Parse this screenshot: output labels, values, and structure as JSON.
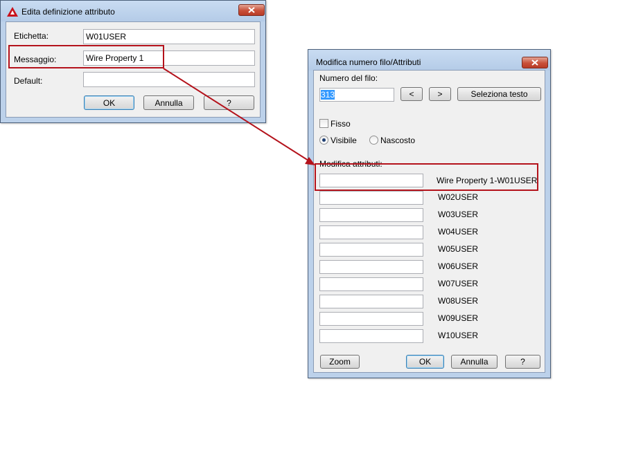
{
  "dialog1": {
    "title": "Edita definizione attributo",
    "fields": [
      {
        "label": "Etichetta:",
        "value": "W01USER"
      },
      {
        "label": "Messaggio:",
        "value": "Wire Property 1"
      },
      {
        "label": "Default:",
        "value": ""
      }
    ],
    "buttons": {
      "ok": "OK",
      "cancel": "Annulla",
      "help": "?"
    }
  },
  "dialog2": {
    "title": "Modifica numero filo/Attributi",
    "wire_number_label": "Numero del filo:",
    "wire_number_value": "313",
    "prev": "<",
    "next": ">",
    "select_text": "Seleziona testo",
    "fixed_label": "Fisso",
    "visible_label": "Visibile",
    "hidden_label": "Nascosto",
    "edit_attributes_label": "Modifica attributi:",
    "attributes": [
      {
        "value": "",
        "name": "Wire Property 1-W01USER"
      },
      {
        "value": "",
        "name": "W02USER"
      },
      {
        "value": "",
        "name": "W03USER"
      },
      {
        "value": "",
        "name": "W04USER"
      },
      {
        "value": "",
        "name": "W05USER"
      },
      {
        "value": "",
        "name": "W06USER"
      },
      {
        "value": "",
        "name": "W07USER"
      },
      {
        "value": "",
        "name": "W08USER"
      },
      {
        "value": "",
        "name": "W09USER"
      },
      {
        "value": "",
        "name": "W10USER"
      }
    ],
    "buttons": {
      "zoom": "Zoom",
      "ok": "OK",
      "cancel": "Annulla",
      "help": "?"
    }
  },
  "colors": {
    "highlight": "#b4121b",
    "title_bar": "#c9dcf2",
    "close_button": "#c9503a"
  },
  "icons": {
    "app": "autocad-logo-icon",
    "close": "close-icon",
    "arrow": "annotation-arrow"
  }
}
